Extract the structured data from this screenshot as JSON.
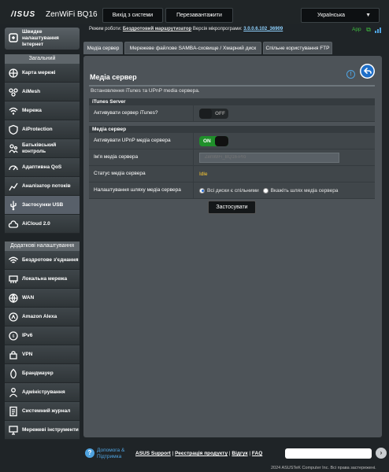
{
  "header": {
    "logo": "/ISUS",
    "model": "ZenWiFi BQ16",
    "logout_label": "Вихід з системи",
    "reboot_label": "Перезавантажити",
    "language": "Українська"
  },
  "status": {
    "mode_label": "Режим роботи:",
    "mode_value": "Бездротовий маршрутизатор",
    "fw_label": "Версія мікропрограми:",
    "fw_value": "3.0.0.6.102_36909",
    "ssid_label": "SSID:",
    "app_label": "App"
  },
  "sidebar": {
    "quick": "Швидке налаштування Інтернет",
    "general_title": "Загальний",
    "general": [
      {
        "label": "Карта мережі",
        "icon": "network-map-icon"
      },
      {
        "label": "AiMesh",
        "icon": "aimesh-icon"
      },
      {
        "label": "Мережа",
        "icon": "network-icon"
      },
      {
        "label": "AiProtection",
        "icon": "aiprotection-icon"
      },
      {
        "label": "Батьківський контроль",
        "icon": "parental-control-icon"
      },
      {
        "label": "Адаптивна QoS",
        "icon": "qos-icon"
      },
      {
        "label": "Аналізатор потоків",
        "icon": "traffic-analyzer-icon"
      },
      {
        "label": "Застосунки USB",
        "icon": "usb-icon"
      },
      {
        "label": "AiCloud 2.0",
        "icon": "aicloud-icon"
      }
    ],
    "advanced_title": "Додаткові налаштування",
    "advanced": [
      {
        "label": "Бездротове з'єднання",
        "icon": "wireless-icon"
      },
      {
        "label": "Локальна мережа",
        "icon": "lan-icon"
      },
      {
        "label": "WAN",
        "icon": "wan-icon"
      },
      {
        "label": "Amazon Alexa",
        "icon": "alexa-icon"
      },
      {
        "label": "IPv6",
        "icon": "ipv6-icon"
      },
      {
        "label": "VPN",
        "icon": "vpn-icon"
      },
      {
        "label": "Брандмауер",
        "icon": "firewall-icon"
      },
      {
        "label": "Адміністрування",
        "icon": "administration-icon"
      },
      {
        "label": "Системний журнал",
        "icon": "system-log-icon"
      },
      {
        "label": "Мережеві інструменти",
        "icon": "network-tools-icon"
      }
    ]
  },
  "tabs": [
    {
      "label": "Медіа сервер"
    },
    {
      "label": "Мережеве файлове SAMBA-сховище / Хмарний диск"
    },
    {
      "label": "Спільне користування FTP"
    }
  ],
  "main": {
    "title": "Медіа сервер",
    "description": "Встановлення iTunes та UPnP media сервера.",
    "itunes_header": "iTunes Server",
    "itunes_label": "Активувати сервер iTunes?",
    "itunes_state": "OFF",
    "media_header": "Медіа сервер",
    "upnp_label": "Активувати UPnP медіа сервера",
    "upnp_state": "ON",
    "name_label": "Ім'я медіа сервера",
    "name_placeholder": "ZenWiFi_BQ16-Pro",
    "status_label": "Статус медіа сервера",
    "status_value": "Idle",
    "path_label": "Налаштування шляху медіа сервера",
    "path_opt1": "Всі диски є спільними",
    "path_opt2": "Вкажіть шлях медіа сервера",
    "apply_label": "Застосувати"
  },
  "footer": {
    "help": "Допомога & Підтримка",
    "link1": "ASUS Support",
    "link2": "Реєстрація продукту",
    "link3": "Відгук",
    "link4": "FAQ",
    "copyright": "2024 ASUSTeK Computer Inc. Всі права застережені."
  }
}
